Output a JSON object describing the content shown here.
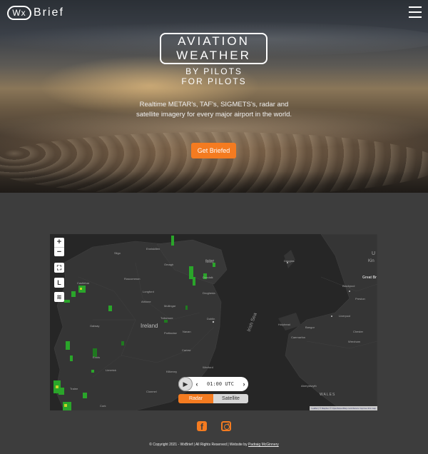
{
  "header": {
    "logo_mark": "Wx",
    "logo_text": "Brief",
    "menu_icon": "hamburger-menu-icon"
  },
  "hero": {
    "title_line1": "AVIATION",
    "title_line2": "WEATHER",
    "subtitle_line1": "BY PILOTS",
    "subtitle_line2": "FOR PILOTS",
    "tagline": "Realtime METAR's, TAF's, SIGMETS's, radar and satellite imagery for every major airport in the world.",
    "cta_label": "Get Briefed",
    "accent_color": "#f47b20"
  },
  "map": {
    "zoom_in": "+",
    "zoom_out": "−",
    "fullscreen_icon": "fullscreen-icon",
    "legend_button": "L",
    "layers_icon": "layers-icon",
    "labels": {
      "ireland": "Ireland",
      "irish_sea": "Irish Sea",
      "wales": "WALES",
      "great_britain": "Great Br",
      "kingdom": "Kin",
      "united": "U",
      "dublin": "Dublin",
      "douglas": "Douglas",
      "blackpool": "Blackpool",
      "liverpool": "Liverpool",
      "belfast": "Belfast",
      "enniskillen": "Enniskillen",
      "sligo": "Sligo",
      "galway": "Galway",
      "limerick": "Limerick",
      "athlone": "Athlone",
      "dundalk": "Dundalk",
      "drogheda": "Drogheda",
      "wexford": "Wexford",
      "cork": "Cork",
      "castlebar": "Castlebar",
      "kilkenny": "Kilkenny",
      "carlow": "Carlow",
      "chester": "Chester",
      "wrexham": "Wrexham",
      "caernarfon": "Caernarfon",
      "holyhead": "Holyhead",
      "bangor": "Bangor",
      "preston": "Preston",
      "aberystwyth": "Aberystwyth",
      "mullingar": "Mullingar",
      "longford": "Longford",
      "tullamore": "Tullamore",
      "portlaoise": "Portlaoise",
      "navan": "Navan",
      "newry": "Newry",
      "omagh": "Omagh",
      "ennis": "Ennis",
      "clonmel": "Clonmel",
      "tralee": "Tralee",
      "roscommon": "Roscommon"
    },
    "player": {
      "play_icon": "play-icon",
      "prev_icon": "chevron-left-icon",
      "time": "01:00 UTC",
      "next_icon": "chevron-right-icon"
    },
    "toggle": {
      "radar": "Radar",
      "satellite": "Satellite",
      "active": "Radar"
    },
    "attribution": "Leaflet | © Mapbox © OpenStreetMap contributors Improve this map"
  },
  "footer": {
    "facebook_icon": "facebook-icon",
    "instagram_icon": "instagram-icon",
    "copyright": "© Copyright 2021 - WxBrief | All Rights Reserved | Website by",
    "author_link": "Padraig McGinnery"
  }
}
